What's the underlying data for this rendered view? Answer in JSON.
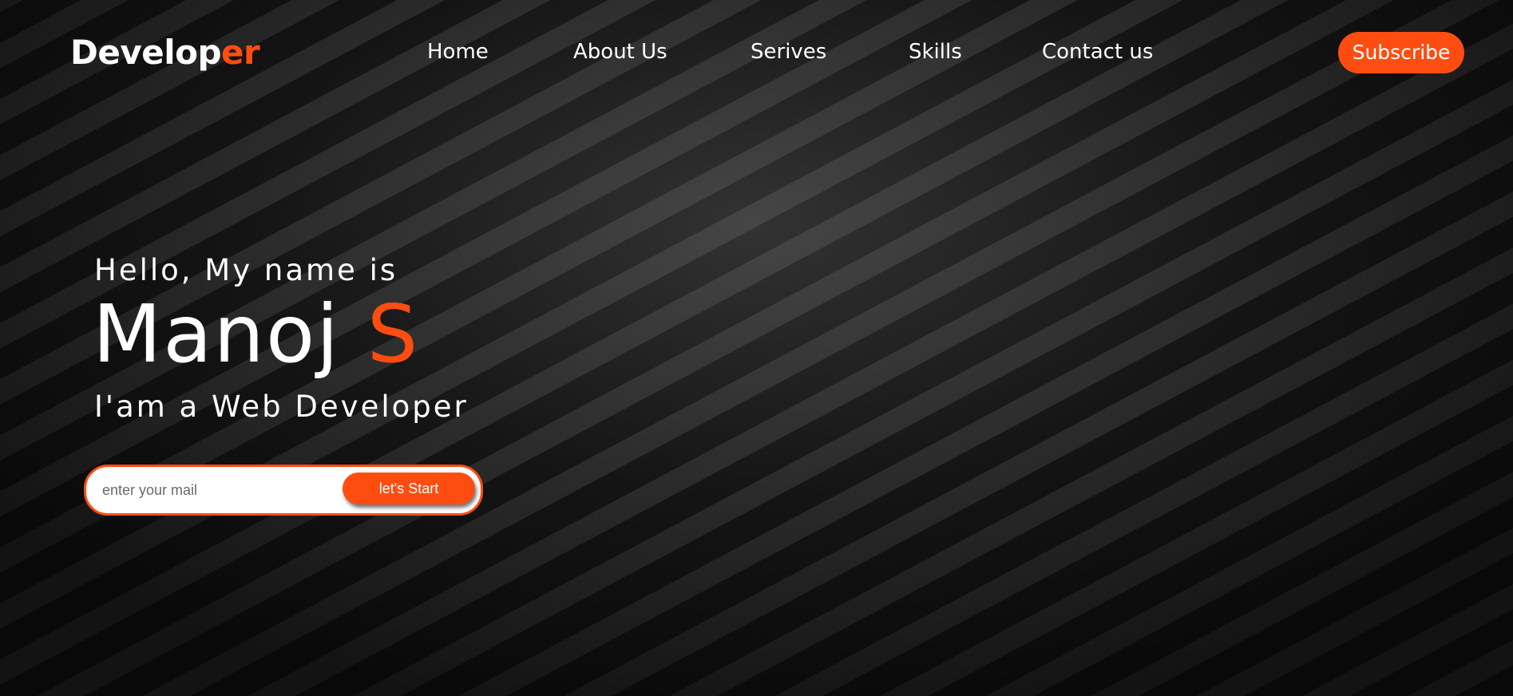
{
  "nav": {
    "logo_main": "Develop",
    "logo_accent": "er",
    "links": [
      {
        "label": "Home"
      },
      {
        "label": "About Us"
      },
      {
        "label": "Serives"
      },
      {
        "label": "Skills"
      },
      {
        "label": "Contact us"
      }
    ],
    "subscribe_label": "Subscribe"
  },
  "hero": {
    "greeting": "Hello, My name is",
    "name_first": "Manoj ",
    "name_accent": "S",
    "role": "I'am a Web Developer"
  },
  "form": {
    "email_placeholder": "enter your mail",
    "email_value": "",
    "submit_label": "let's Start"
  },
  "colors": {
    "accent": "#ff4d12",
    "background": "#111111",
    "text": "#ffffff"
  }
}
